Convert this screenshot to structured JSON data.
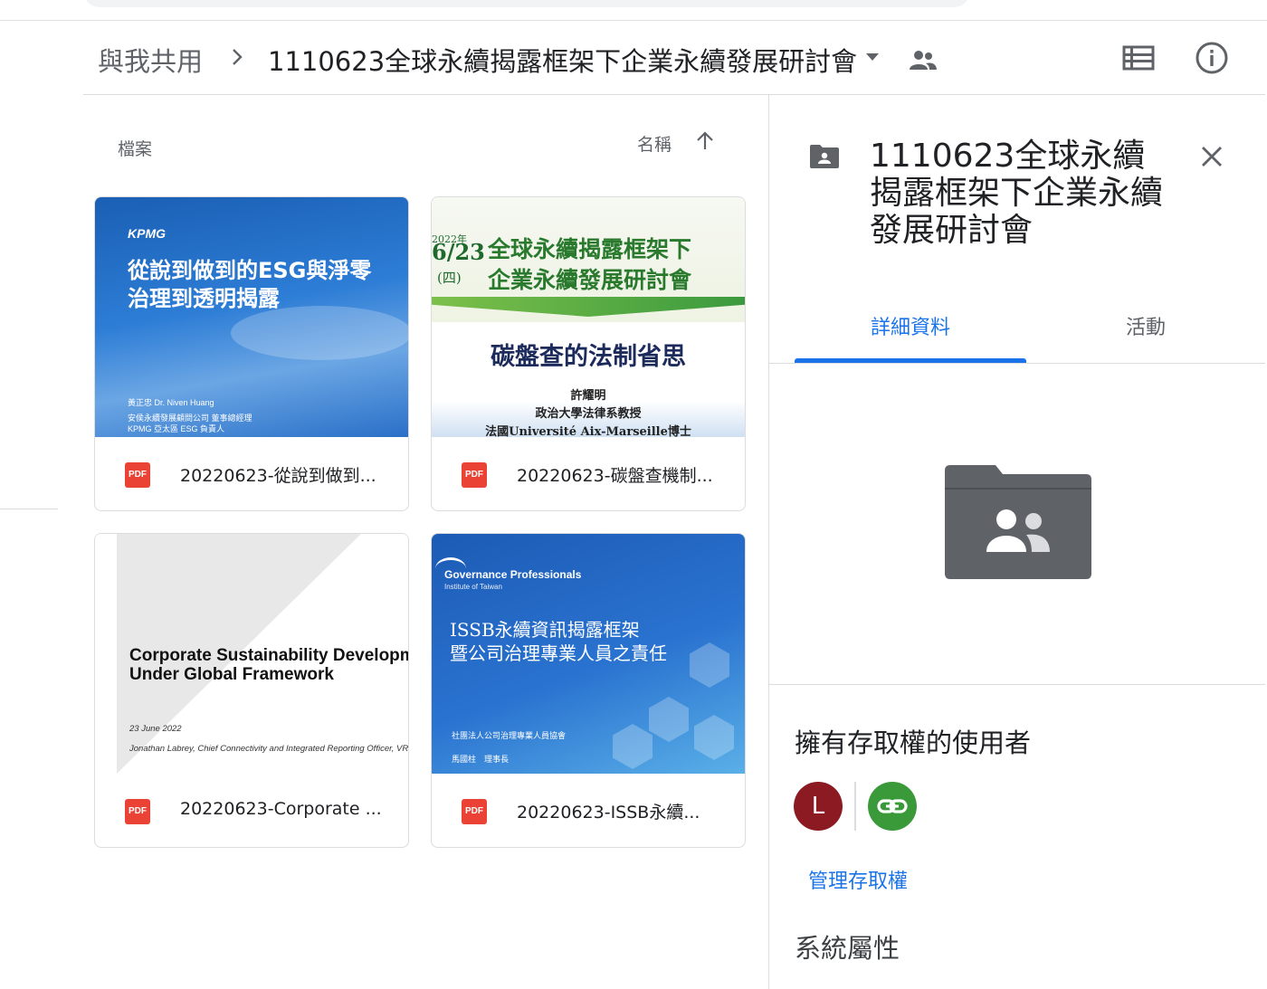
{
  "header": {
    "breadcrumb_root": "與我共用",
    "breadcrumb_current": "1110623全球永續揭露框架下企業永續發展研討會"
  },
  "files": {
    "section_label": "檔案",
    "sort_label": "名稱",
    "cards": [
      {
        "name": "20220623-從說到做到...",
        "badge": "PDF",
        "thumb": {
          "logo": "KPMG",
          "title_line1": "從說到做到的ESG與淨零",
          "title_line2": "治理到透明揭露",
          "speaker": "黃正忠 Dr. Niven Huang",
          "role1": "安侯永續發展顧問公司 董事總經理",
          "role2": "KPMG 亞太區 ESG 負責人"
        }
      },
      {
        "name": "20220623-碳盤查機制...",
        "badge": "PDF",
        "thumb": {
          "year": "2022年",
          "date": "6/23",
          "weekday": "(四)",
          "headline1": "全球永續揭露框架下",
          "headline2": "企業永續發展研討會",
          "subject": "碳盤查的法制省思",
          "speaker": "許耀明",
          "role1": "政治大學法律系教授",
          "role2": "法國Université Aix-Marseille博士"
        }
      },
      {
        "name": "20220623-Corporate ...",
        "badge": "PDF",
        "thumb": {
          "title_line1": "Corporate Sustainability Developme",
          "title_line2": "Under Global Framework",
          "date": "23 June 2022",
          "speaker": "Jonathan Labrey, Chief Connectivity and Integrated Reporting Officer, VRF"
        }
      },
      {
        "name": "20220623-ISSB永續...",
        "badge": "PDF",
        "thumb": {
          "logo": "Governance Professionals",
          "logo_sub": "Institute of Taiwan",
          "title_line1": "ISSB永續資訊揭露框架",
          "title_line2": "暨公司治理專業人員之責任",
          "org": "社團法人公司治理專業人員協會",
          "speaker": "馬國柱　理事長"
        }
      }
    ]
  },
  "details": {
    "title": "1110623全球永續揭露框架下企業永續發展研討會",
    "tabs": [
      "詳細資料",
      "活動"
    ],
    "active_tab": 0,
    "access_heading": "擁有存取權的使用者",
    "avatar_letter": "L",
    "manage_access": "管理存取權",
    "properties_heading": "系統屬性"
  },
  "colors": {
    "accent": "#1a73e8",
    "pdf_red": "#ea4335",
    "avatar_l": "#8b1a23",
    "avatar_link": "#3a9a3a",
    "folder_grey": "#5f6368"
  },
  "icons": [
    "chevron-right-icon",
    "dropdown-arrow-icon",
    "shared-people-icon",
    "list-view-icon",
    "info-icon",
    "sort-arrow-up-icon",
    "shared-folder-icon",
    "close-icon",
    "link-icon"
  ]
}
